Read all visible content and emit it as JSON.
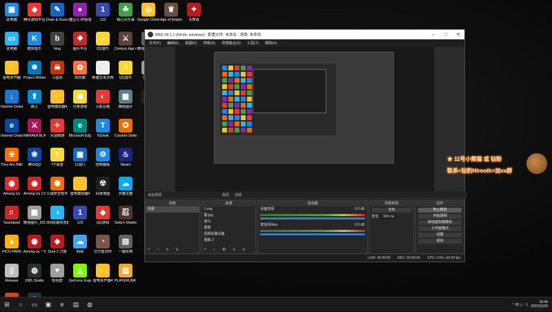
{
  "desktop_icons": [
    {
      "label": "此电脑",
      "glyph": "▣",
      "color": "#1e88e5",
      "pos": "c0r0"
    },
    {
      "label": "腾讯游戏平台",
      "glyph": "◆",
      "color": "#e53935"
    },
    {
      "label": "Draw & Guess",
      "glyph": "✎",
      "color": "#1565c0"
    },
    {
      "label": "糖豆人:终极淘汰赛",
      "glyph": "●",
      "color": "#8e24aa"
    },
    {
      "label": "123",
      "glyph": "1",
      "color": "#3949ab"
    },
    {
      "label": "我心大乐事",
      "glyph": "☘",
      "color": "#43a047"
    },
    {
      "label": "Google Chrome",
      "glyph": "◎",
      "color": "#fbc02d"
    },
    {
      "label": "Age of Empires IV",
      "glyph": "♛",
      "color": "#6d4c41"
    },
    {
      "label": "大表政",
      "glyph": "✦",
      "color": "#b71c1c"
    },
    {
      "label": "此电脑",
      "glyph": "▭",
      "color": "#29b6f6"
    },
    {
      "label": "酷狗音乐",
      "glyph": "K",
      "color": "#1e88e5"
    },
    {
      "label": "bing",
      "glyph": "b",
      "color": "#424242"
    },
    {
      "label": "图片平台",
      "glyph": "❖",
      "color": "#c62828"
    },
    {
      "label": "QQ音乐",
      "glyph": "♪",
      "color": "#fdd835"
    },
    {
      "label": "Century Age of Ashes",
      "glyph": "⚔",
      "color": "#5d4037"
    },
    {
      "label": "微信图片_2020",
      "glyph": "▦",
      "color": "#616161"
    },
    {
      "label": "雷电多开器",
      "glyph": "⚡",
      "color": "#fbc02d"
    },
    {
      "label": "Project Winter",
      "glyph": "❄",
      "color": "#0277bd"
    },
    {
      "label": "三国杀",
      "glyph": "☠",
      "color": "#bf360c"
    },
    {
      "label": "向日葵",
      "glyph": "✿",
      "color": "#ff7043"
    },
    {
      "label": "新建文本文档",
      "glyph": "≡",
      "color": "#eeeeee"
    },
    {
      "label": "QQ音乐",
      "glyph": "♫",
      "color": "#fdd835"
    },
    {
      "label": "表情包",
      "glyph": "☺",
      "color": "#9e9e9e"
    },
    {
      "label": "Internet Download",
      "glyph": "↓",
      "color": "#1976d2"
    },
    {
      "label": "跳入",
      "glyph": "⬆",
      "color": "#0288d1"
    },
    {
      "label": "雷电模拟器4",
      "glyph": "⚡",
      "color": "#fbc02d"
    },
    {
      "label": "分身游戏",
      "glyph": "☗",
      "color": "#fdd835"
    },
    {
      "label": "火影忍者",
      "glyph": "◐",
      "color": "#e53935"
    },
    {
      "label": "微信图片",
      "glyph": "▦",
      "color": "#607d8b"
    },
    {
      "label": "geek",
      "glyph": "g",
      "color": "#212121"
    },
    {
      "label": "Internet Downlo",
      "glyph": "e",
      "color": "#0d47a1"
    },
    {
      "label": "NARAKA BLADEPOINT",
      "glyph": "⚔",
      "color": "#ad1457"
    },
    {
      "label": "大话西游",
      "glyph": "✧",
      "color": "#e53935"
    },
    {
      "label": "Microsoft Edge",
      "glyph": "e",
      "color": "#00897b"
    },
    {
      "label": "ToDesk",
      "glyph": "T",
      "color": "#1e88e5"
    },
    {
      "label": "Counter-Strike",
      "glyph": "✪",
      "color": "#ef6c00"
    },
    {
      "label": "They Are Billions",
      "glyph": "☣",
      "color": "#ff6f00"
    },
    {
      "label": "腾讯QQ",
      "glyph": "❀",
      "color": "#0d47a1"
    },
    {
      "label": "YY语音",
      "glyph": "Y",
      "color": "#fdd835"
    },
    {
      "label": "11运行",
      "glyph": "▣",
      "color": "#1565c0"
    },
    {
      "label": "控制面板",
      "glyph": "⚙",
      "color": "#1e88e5"
    },
    {
      "label": "Steam",
      "glyph": "♨",
      "color": "#1a237e"
    },
    {
      "label": "Among Us",
      "glyph": "◉",
      "color": "#d32f2f"
    },
    {
      "label": "Among Us 2.6.7 TDE",
      "glyph": "◉",
      "color": "#c62828"
    },
    {
      "label": "火绒安全软件",
      "glyph": "⬢",
      "color": "#ef6c00"
    },
    {
      "label": "雷电模拟器4",
      "glyph": "⚡",
      "color": "#fbc02d"
    },
    {
      "label": "白夜地图",
      "glyph": "☢",
      "color": "#212121"
    },
    {
      "label": "天翼云盘",
      "glyph": "☁",
      "color": "#03a9f4"
    },
    {
      "label": "Soundpad",
      "glyph": "♬",
      "color": "#c62828"
    },
    {
      "label": "微信图片_20181012",
      "glyph": "▦",
      "color": "#9e9e9e"
    },
    {
      "label": "360极速浏览器",
      "glyph": "◑",
      "color": "#29b6f6"
    },
    {
      "label": "123",
      "glyph": "1",
      "color": "#3949ab"
    },
    {
      "label": "QQ游戏",
      "glyph": "◆",
      "color": "#e53935"
    },
    {
      "label": "Sekiro Shadows",
      "glyph": "忍",
      "color": "#4e342e"
    },
    {
      "label": "PICO PARK",
      "glyph": "▲",
      "color": "#ffb300"
    },
    {
      "label": "Among us 一键汉化",
      "glyph": "◉",
      "color": "#b71c1c"
    },
    {
      "label": "Dota 2 刀塔",
      "glyph": "◈",
      "color": "#b71c1c"
    },
    {
      "label": "网易",
      "glyph": "☁",
      "color": "#42a5f5"
    },
    {
      "label": "艾尔登法环",
      "glyph": "◔",
      "color": "#795548"
    },
    {
      "label": "一键实用",
      "glyph": "▤",
      "color": "#616161"
    },
    {
      "label": "Release",
      "glyph": "▯",
      "color": "#bdbdbd"
    },
    {
      "label": "OBS Studio",
      "glyph": "◍",
      "color": "#263238"
    },
    {
      "label": "粉丝群",
      "glyph": "♥",
      "color": "#9e9e9e"
    },
    {
      "label": "GeForce Experience",
      "glyph": "◭",
      "color": "#76ff03"
    },
    {
      "label": "雷电多开器4",
      "glyph": "⚡",
      "color": "#fbc02d"
    },
    {
      "label": "PLAYERUNK BATTLEGR",
      "glyph": "▤",
      "color": "#f9a825"
    },
    {
      "label": "SEXI战斗平台",
      "glyph": "☼",
      "color": "#d84315"
    },
    {
      "label": "Logitech G HUB",
      "glyph": "G",
      "color": "#263238"
    }
  ],
  "obs": {
    "title": "OBS 28.1.1 (64-bit, windows) - 配置文件: 未命名 - 场景: 未命名",
    "menu": [
      "文件(F)",
      "编辑(E)",
      "视图(V)",
      "停靠(D)",
      "场景集合(S)",
      "工具(T)",
      "帮助(H)"
    ],
    "win_min": "–",
    "win_max": "□",
    "win_close": "✕",
    "no_source": "未选择源",
    "props_label": "属性",
    "filters_label": "滤镜",
    "docks": {
      "scenes_title": "场景",
      "scenes": [
        "场景"
      ],
      "sources_title": "来源",
      "sources": [
        "1.svg",
        "图.jpg",
        "窗口",
        "图像",
        "视频采集设备",
        "图像 2"
      ],
      "mixer_title": "混音器",
      "mixer_ch1": "桌面音频",
      "mixer_ch1_db": "0.0 dB",
      "mixer_ch2": "麦克风/Aux",
      "mixer_ch2_db": "0.0 dB",
      "transitions_title": "场景转场",
      "transition_value": "淡出",
      "duration_label": "时长",
      "duration_value": "300 ms",
      "controls_title": "控件",
      "controls": [
        "停止推流",
        "开始录制",
        "启动虚拟摄像机",
        "工作室模式",
        "设置",
        "退出"
      ]
    },
    "status": {
      "live": "LIVE: 00:00:00",
      "rec": "REC: 00:00:00",
      "cpu": "CPU: 0.6%, 60.00 fps"
    }
  },
  "overlay": {
    "line1": "★ 11号小熊猫 或 钻粉",
    "line2": "联系<钻豹Hireoth>加vx群"
  },
  "taskbar": {
    "start": "⊞",
    "search": "○",
    "taskview": "▭",
    "apps": [
      "▣",
      "e",
      "▤",
      "◍"
    ],
    "tray_text": "^ 英 ◻ ◁)",
    "time": "16:46",
    "date": "2022/11/23"
  }
}
